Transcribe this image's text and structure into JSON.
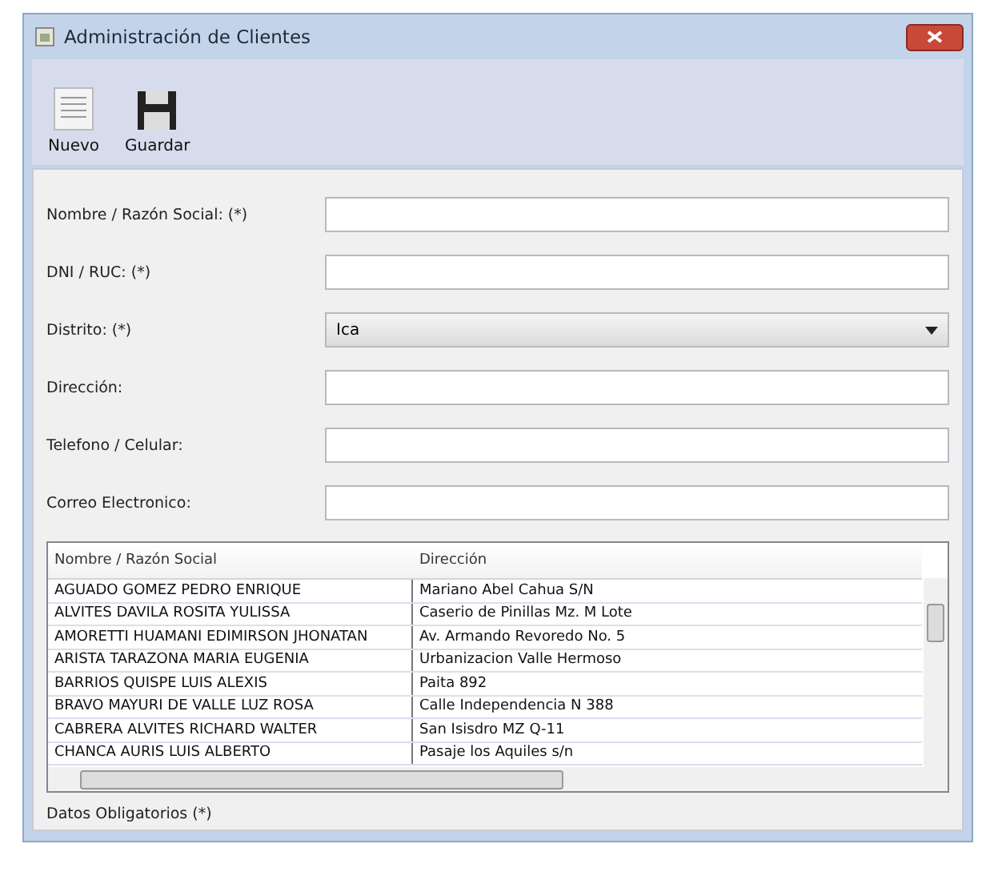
{
  "window": {
    "title": "Administración de Clientes"
  },
  "toolbar": [
    {
      "label": "Nuevo",
      "kind": "new"
    },
    {
      "label": "Guardar",
      "kind": "save"
    }
  ],
  "form": [
    {
      "label": "Nombre / Razón Social: (*)",
      "kind": "text"
    },
    {
      "label": "DNI / RUC:  (*)",
      "kind": "text"
    },
    {
      "label": "Distrito: (*)",
      "kind": "select",
      "value": "Ica"
    },
    {
      "label": "Dirección:",
      "kind": "text"
    },
    {
      "label": "Telefono / Celular:",
      "kind": "text"
    },
    {
      "label": "Correo Electronico:",
      "kind": "text"
    }
  ],
  "table": {
    "columns": [
      "Nombre / Razón Social",
      "Dirección"
    ],
    "rows": [
      [
        "AGUADO GOMEZ PEDRO ENRIQUE",
        "Mariano Abel Cahua S/N"
      ],
      [
        "ALVITES DAVILA ROSITA YULISSA",
        "Caserio de Pinillas Mz. M Lote"
      ],
      [
        "AMORETTI HUAMANI EDIMIRSON JHONATAN",
        "Av. Armando Revoredo No. 5"
      ],
      [
        "ARISTA TARAZONA MARIA EUGENIA",
        "Urbanizacion Valle Hermoso"
      ],
      [
        "BARRIOS QUISPE LUIS ALEXIS",
        "Paita 892"
      ],
      [
        "BRAVO MAYURI DE VALLE LUZ ROSA",
        "Calle Independencia N 388"
      ],
      [
        "CABRERA ALVITES RICHARD WALTER",
        "San Isisdro MZ Q-11"
      ],
      [
        "CHANCA AURIS LUIS ALBERTO",
        "Pasaje los Aquiles s/n"
      ]
    ]
  },
  "footer": "Datos Obligatorios (*)"
}
